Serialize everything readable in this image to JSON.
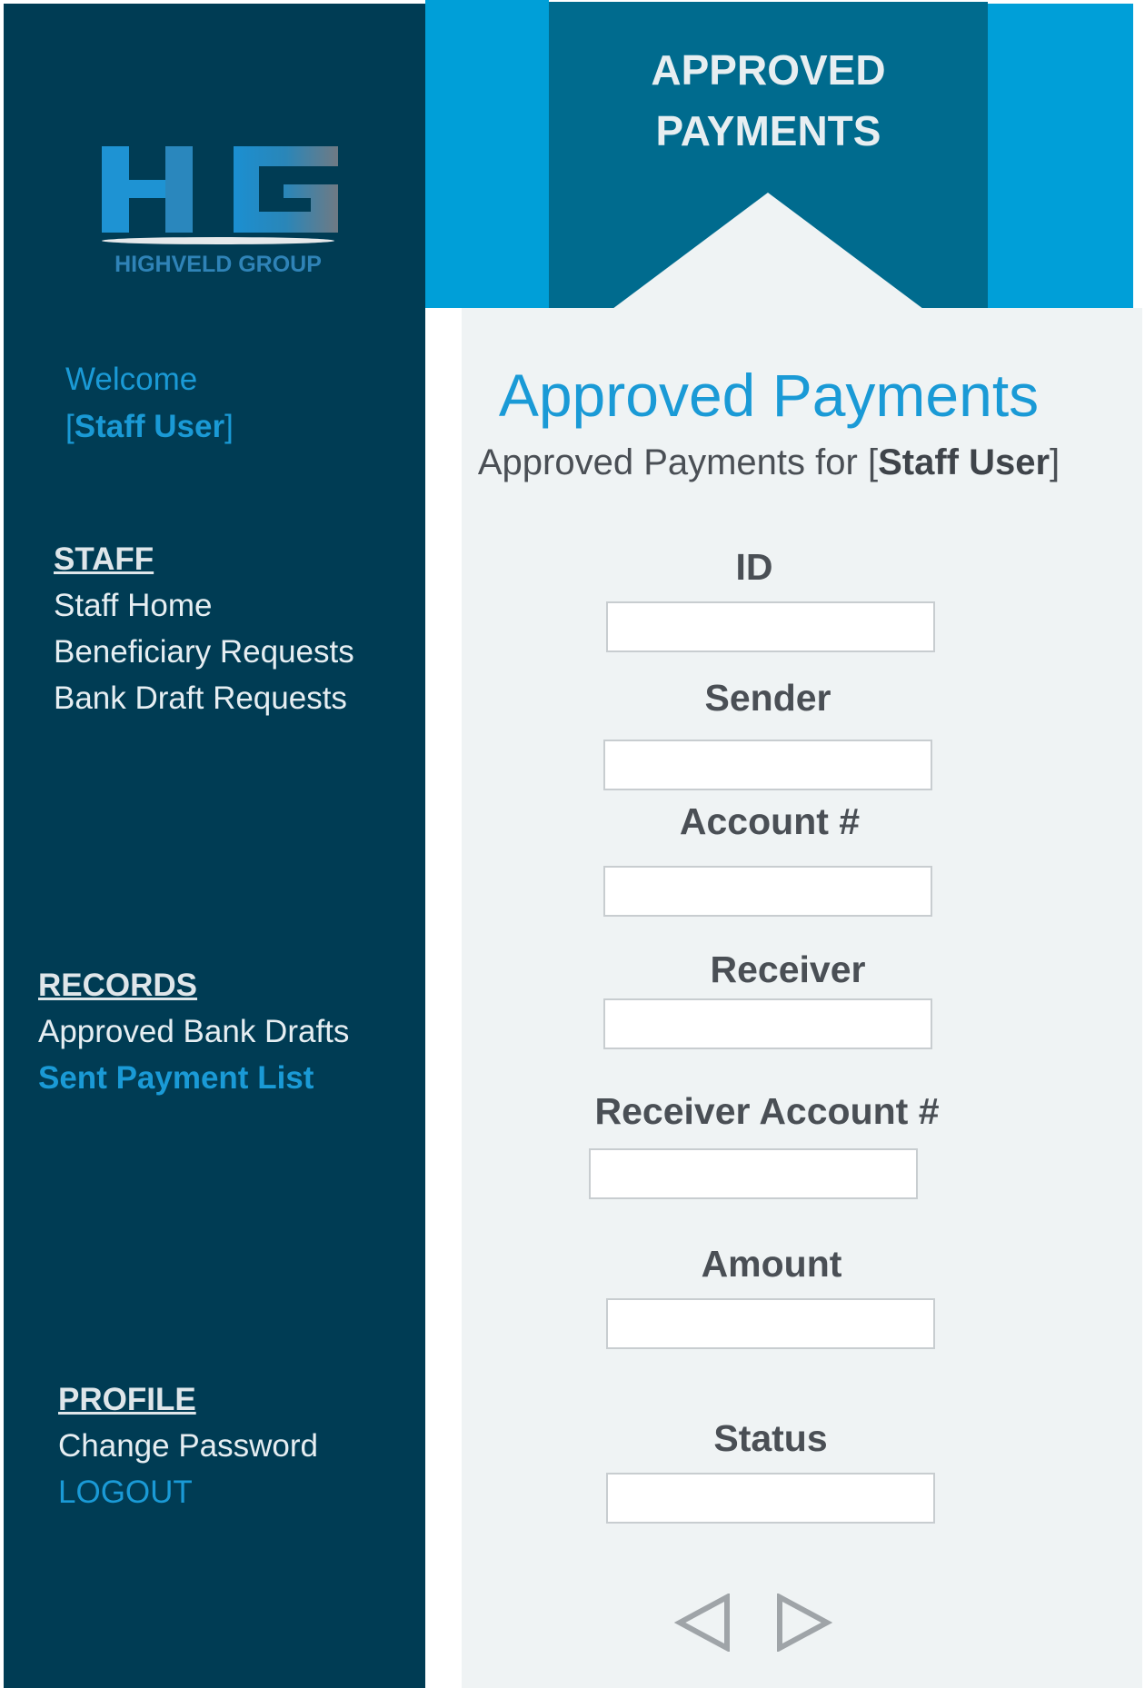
{
  "banner": {
    "title_line1": "APPROVED",
    "title_line2": "PAYMENTS"
  },
  "logo": {
    "icon": "hg-logo-icon",
    "caption": "HIGHVELD GROUP"
  },
  "user": {
    "welcome": "Welcome",
    "name": "Staff User"
  },
  "sidebar": {
    "staff": {
      "heading": "STAFF",
      "items": [
        "Staff Home",
        "Beneficiary Requests",
        "Bank Draft Requests"
      ]
    },
    "records": {
      "heading": "RECORDS",
      "items": [
        "Approved Bank Drafts",
        "Sent Payment List"
      ],
      "active": "Sent Payment List"
    },
    "profile": {
      "heading": "PROFILE",
      "items": [
        "Change Password",
        "LOGOUT"
      ]
    }
  },
  "main": {
    "title": "Approved Payments",
    "subtitle_prefix": "Approved Payments for",
    "subtitle_user": "Staff User",
    "fields": {
      "id": {
        "label": "ID",
        "value": ""
      },
      "sender": {
        "label": "Sender",
        "value": ""
      },
      "account": {
        "label": "Account #",
        "value": ""
      },
      "receiver": {
        "label": "Receiver",
        "value": ""
      },
      "receiver_account": {
        "label": "Receiver Account #",
        "value": ""
      },
      "amount": {
        "label": "Amount",
        "value": ""
      },
      "status": {
        "label": "Status",
        "value": ""
      }
    },
    "pager": {
      "prev_icon": "triangle-left-icon",
      "next_icon": "triangle-right-icon"
    }
  },
  "colors": {
    "sidebar_bg": "#003c54",
    "banner_light": "#009fd8",
    "banner_dark": "#006b8e",
    "accent": "#1a9ad6",
    "content_bg": "#eff3f4"
  }
}
